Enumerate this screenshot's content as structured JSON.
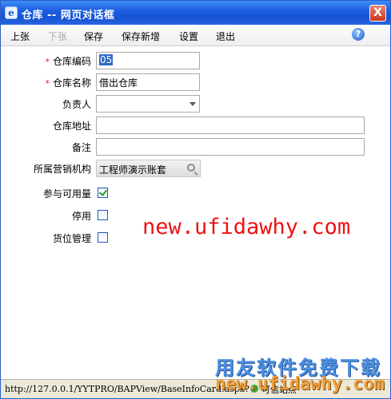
{
  "window": {
    "title": "仓库 -- 网页对话框",
    "close_label": "X"
  },
  "toolbar": {
    "prev": "上张",
    "next": "下张",
    "save": "保存",
    "save_new": "保存新增",
    "settings": "设置",
    "exit": "退出",
    "help": "?"
  },
  "form": {
    "code": {
      "label": "仓库编码",
      "value": "05",
      "required_mark": "*"
    },
    "name": {
      "label": "仓库名称",
      "value": "借出仓库",
      "required_mark": "*"
    },
    "manager": {
      "label": "负责人",
      "value": ""
    },
    "address": {
      "label": "仓库地址",
      "value": ""
    },
    "remark": {
      "label": "备注",
      "value": ""
    },
    "org": {
      "label": "所属营销机构",
      "value": "工程师演示账套"
    },
    "available": {
      "label": "参与可用量",
      "checked": true
    },
    "disabled": {
      "label": "停用",
      "checked": false
    },
    "location": {
      "label": "货位管理",
      "checked": false
    }
  },
  "watermark": {
    "url": "new.ufidawhy.com",
    "cn": "用友软件免费下载",
    "url2": "new.ufidawhy.com"
  },
  "statusbar": {
    "url": "http://127.0.0.1/YYTPRO/BAPView/BaseInfoCard.aspx?",
    "zone": "可信站点"
  }
}
